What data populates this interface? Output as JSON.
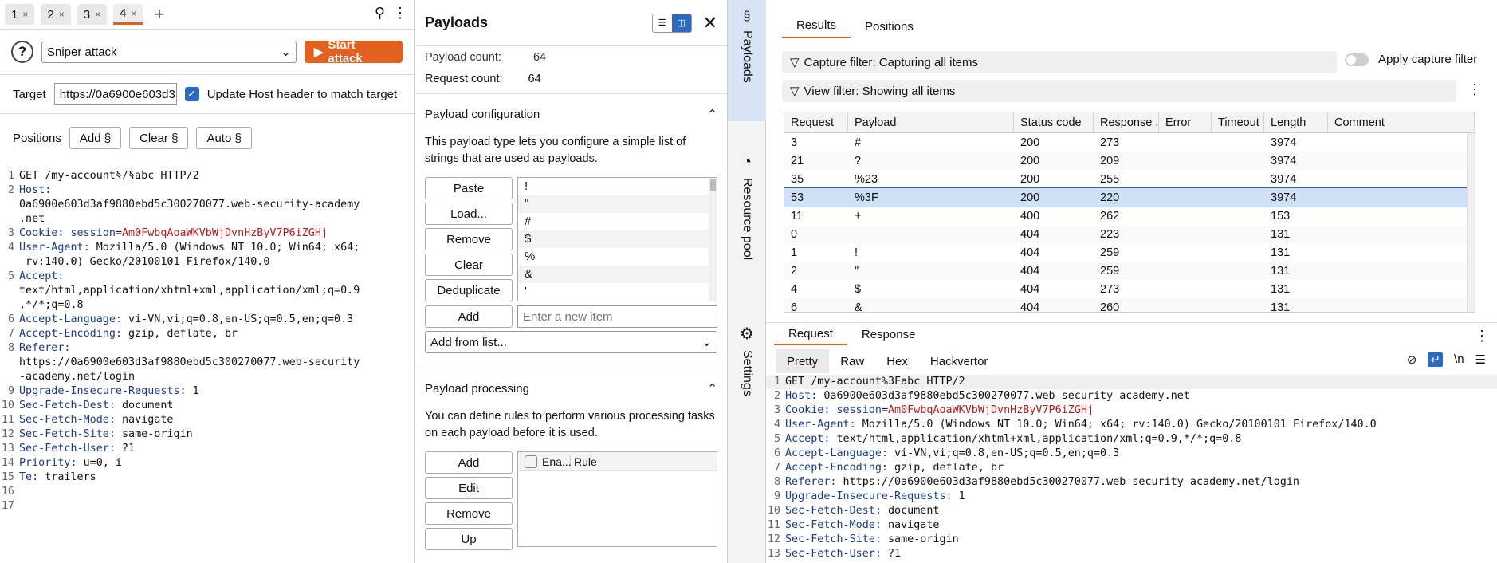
{
  "tabs": [
    {
      "label": "1"
    },
    {
      "label": "2"
    },
    {
      "label": "3"
    },
    {
      "label": "4",
      "active": true
    }
  ],
  "tab_close_glyph": "×",
  "tab_add_glyph": "+",
  "attack": {
    "help_glyph": "?",
    "type": "Sniper attack",
    "start_label": "Start attack"
  },
  "target": {
    "label": "Target",
    "value": "https://0a6900e603d3",
    "update_host_label": "Update Host header to match target",
    "update_host_checked": true
  },
  "positions": {
    "label": "Positions",
    "add": "Add §",
    "clear": "Clear §",
    "auto": "Auto §"
  },
  "request_lines": [
    {
      "n": "1",
      "parts": [
        [
          "t",
          "GET /my-account§/§abc HTTP/2"
        ]
      ]
    },
    {
      "n": "2",
      "parts": [
        [
          "k",
          "Host:"
        ]
      ]
    },
    {
      "n": "",
      "parts": [
        [
          "t",
          "0a6900e603d3af9880ebd5c300270077.web-security-academy"
        ]
      ]
    },
    {
      "n": "",
      "parts": [
        [
          "t",
          ".net"
        ]
      ]
    },
    {
      "n": "3",
      "parts": [
        [
          "k",
          "Cookie: "
        ],
        [
          "k",
          "session"
        ],
        [
          "t",
          "="
        ],
        [
          "v",
          "Am0FwbqAoaWKVbWjDvnHzByV7P6iZGHj"
        ]
      ]
    },
    {
      "n": "4",
      "parts": [
        [
          "k",
          "User-Agent:"
        ],
        [
          "t",
          " Mozilla/5.0 (Windows NT 10.0; Win64; x64;"
        ]
      ]
    },
    {
      "n": "",
      "parts": [
        [
          "t",
          " rv:140.0) Gecko/20100101 Firefox/140.0"
        ]
      ]
    },
    {
      "n": "5",
      "parts": [
        [
          "k",
          "Accept:"
        ]
      ]
    },
    {
      "n": "",
      "parts": [
        [
          "t",
          "text/html,application/xhtml+xml,application/xml;q=0.9"
        ]
      ]
    },
    {
      "n": "",
      "parts": [
        [
          "t",
          ",*/*;q=0.8"
        ]
      ]
    },
    {
      "n": "6",
      "parts": [
        [
          "k",
          "Accept-Language:"
        ],
        [
          "t",
          " vi-VN,vi;q=0.8,en-US;q=0.5,en;q=0.3"
        ]
      ]
    },
    {
      "n": "7",
      "parts": [
        [
          "k",
          "Accept-Encoding:"
        ],
        [
          "t",
          " gzip, deflate, br"
        ]
      ]
    },
    {
      "n": "8",
      "parts": [
        [
          "k",
          "Referer:"
        ]
      ]
    },
    {
      "n": "",
      "parts": [
        [
          "t",
          "https://0a6900e603d3af9880ebd5c300270077.web-security"
        ]
      ]
    },
    {
      "n": "",
      "parts": [
        [
          "t",
          "-academy.net/login"
        ]
      ]
    },
    {
      "n": "9",
      "parts": [
        [
          "k",
          "Upgrade-Insecure-Requests:"
        ],
        [
          "t",
          " 1"
        ]
      ]
    },
    {
      "n": "10",
      "parts": [
        [
          "k",
          "Sec-Fetch-Dest:"
        ],
        [
          "t",
          " document"
        ]
      ]
    },
    {
      "n": "11",
      "parts": [
        [
          "k",
          "Sec-Fetch-Mode:"
        ],
        [
          "t",
          " navigate"
        ]
      ]
    },
    {
      "n": "12",
      "parts": [
        [
          "k",
          "Sec-Fetch-Site:"
        ],
        [
          "t",
          " same-origin"
        ]
      ]
    },
    {
      "n": "13",
      "parts": [
        [
          "k",
          "Sec-Fetch-User:"
        ],
        [
          "t",
          " ?1"
        ]
      ]
    },
    {
      "n": "14",
      "parts": [
        [
          "k",
          "Priority:"
        ],
        [
          "t",
          " u=0, i"
        ]
      ]
    },
    {
      "n": "15",
      "parts": [
        [
          "k",
          "Te:"
        ],
        [
          "t",
          " trailers"
        ]
      ]
    },
    {
      "n": "16",
      "parts": []
    },
    {
      "n": "17",
      "parts": []
    }
  ],
  "payloads": {
    "title": "Payloads",
    "payload_count_label": "Payload count:",
    "payload_count_value": "64",
    "request_count_label": "Request count:",
    "request_count_value": "64",
    "config_title": "Payload configuration",
    "config_desc": "This payload type lets you configure a simple list of strings that are used as payloads.",
    "buttons": [
      "Paste",
      "Load...",
      "Remove",
      "Clear",
      "Deduplicate"
    ],
    "items": [
      "!",
      "\"",
      "#",
      "$",
      "%",
      "&",
      "'"
    ],
    "add_label": "Add",
    "add_placeholder": "Enter a new item",
    "add_from_list": "Add from list...",
    "processing_title": "Payload processing",
    "processing_desc": "You can define rules to perform various processing tasks on each payload before it is used.",
    "processing_buttons": [
      "Add",
      "Edit",
      "Remove",
      "Up"
    ],
    "rule_headers": [
      "Ena...",
      "Rule"
    ]
  },
  "side_tabs": [
    {
      "icon": "§",
      "label": "Payloads",
      "active": true
    },
    {
      "icon": "◔",
      "label": "Resource pool"
    },
    {
      "icon": "⚙",
      "label": "Settings"
    }
  ],
  "results": {
    "tabs": [
      "Results",
      "Positions"
    ],
    "capture_filter": "Capture filter: Capturing all items",
    "apply_capture_filter": "Apply capture filter",
    "view_filter": "View filter: Showing all items",
    "columns": [
      "Request",
      "Payload",
      "Status code",
      "Response ...",
      "Error",
      "Timeout",
      "Length",
      "Comment"
    ],
    "rows": [
      [
        "3",
        "#",
        "200",
        "273",
        "",
        "",
        "3974",
        ""
      ],
      [
        "21",
        "?",
        "200",
        "209",
        "",
        "",
        "3974",
        ""
      ],
      [
        "35",
        "%23",
        "200",
        "255",
        "",
        "",
        "3974",
        ""
      ],
      [
        "53",
        "%3F",
        "200",
        "220",
        "",
        "",
        "3974",
        ""
      ],
      [
        "11",
        "+",
        "400",
        "262",
        "",
        "",
        "153",
        ""
      ],
      [
        "0",
        "",
        "404",
        "223",
        "",
        "",
        "131",
        ""
      ],
      [
        "1",
        "!",
        "404",
        "259",
        "",
        "",
        "131",
        ""
      ],
      [
        "2",
        "\"",
        "404",
        "259",
        "",
        "",
        "131",
        ""
      ],
      [
        "4",
        "$",
        "404",
        "273",
        "",
        "",
        "131",
        ""
      ],
      [
        "6",
        "&",
        "404",
        "260",
        "",
        "",
        "131",
        ""
      ]
    ],
    "selected_row": 3
  },
  "req_resp": {
    "tabs": [
      "Request",
      "Response"
    ],
    "views": [
      "Pretty",
      "Raw",
      "Hex",
      "Hackvertor"
    ],
    "lines": [
      {
        "n": "1",
        "parts": [
          [
            "t",
            "GET /my-account%3Fabc HTTP/2"
          ]
        ]
      },
      {
        "n": "2",
        "parts": [
          [
            "k",
            "Host:"
          ],
          [
            "t",
            " 0a6900e603d3af9880ebd5c300270077.web-security-academy.net"
          ]
        ]
      },
      {
        "n": "3",
        "parts": [
          [
            "k",
            "Cookie: "
          ],
          [
            "k",
            "session"
          ],
          [
            "t",
            "="
          ],
          [
            "v",
            "Am0FwbqAoaWKVbWjDvnHzByV7P6iZGHj"
          ]
        ]
      },
      {
        "n": "4",
        "parts": [
          [
            "k",
            "User-Agent:"
          ],
          [
            "t",
            " Mozilla/5.0 (Windows NT 10.0; Win64; x64; rv:140.0) Gecko/20100101 Firefox/140.0"
          ]
        ]
      },
      {
        "n": "5",
        "parts": [
          [
            "k",
            "Accept:"
          ],
          [
            "t",
            " text/html,application/xhtml+xml,application/xml;q=0.9,*/*;q=0.8"
          ]
        ]
      },
      {
        "n": "6",
        "parts": [
          [
            "k",
            "Accept-Language:"
          ],
          [
            "t",
            " vi-VN,vi;q=0.8,en-US;q=0.5,en;q=0.3"
          ]
        ]
      },
      {
        "n": "7",
        "parts": [
          [
            "k",
            "Accept-Encoding:"
          ],
          [
            "t",
            " gzip, deflate, br"
          ]
        ]
      },
      {
        "n": "8",
        "parts": [
          [
            "k",
            "Referer:"
          ],
          [
            "t",
            " https://0a6900e603d3af9880ebd5c300270077.web-security-academy.net/login"
          ]
        ]
      },
      {
        "n": "9",
        "parts": [
          [
            "k",
            "Upgrade-Insecure-Requests:"
          ],
          [
            "t",
            " 1"
          ]
        ]
      },
      {
        "n": "10",
        "parts": [
          [
            "k",
            "Sec-Fetch-Dest:"
          ],
          [
            "t",
            " document"
          ]
        ]
      },
      {
        "n": "11",
        "parts": [
          [
            "k",
            "Sec-Fetch-Mode:"
          ],
          [
            "t",
            " navigate"
          ]
        ]
      },
      {
        "n": "12",
        "parts": [
          [
            "k",
            "Sec-Fetch-Site:"
          ],
          [
            "t",
            " same-origin"
          ]
        ]
      },
      {
        "n": "13",
        "parts": [
          [
            "k",
            "Sec-Fetch-User:"
          ],
          [
            "t",
            " ?1"
          ]
        ]
      }
    ]
  },
  "colors": {
    "accent": "#e4601f",
    "selection": "#2a6bbf",
    "header_key": "#1a3b8a",
    "cookie_value": "#b31b1b"
  }
}
